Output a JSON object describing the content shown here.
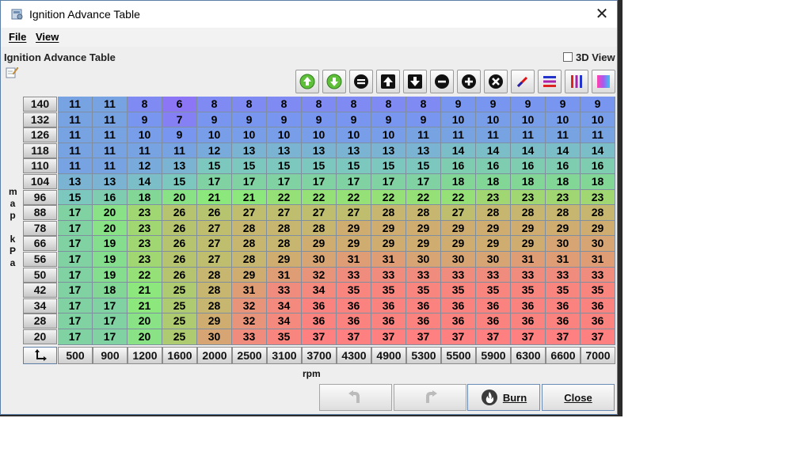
{
  "window": {
    "title": "Ignition Advance Table"
  },
  "menu": {
    "file": "File",
    "view": "View"
  },
  "panel": {
    "title": "Ignition Advance Table",
    "view3d_label": "3D View",
    "view3d_checked": false
  },
  "toolbar": [
    {
      "name": "green-circle-up-button",
      "icon": "green-up-arrow-icon"
    },
    {
      "name": "green-circle-down-button",
      "icon": "green-down-arrow-icon"
    },
    {
      "name": "set-equal-button",
      "icon": "equals-icon"
    },
    {
      "name": "increment-button",
      "icon": "up-arrow-icon"
    },
    {
      "name": "decrement-button",
      "icon": "down-arrow-icon"
    },
    {
      "name": "subtract-button",
      "icon": "minus-icon"
    },
    {
      "name": "add-button",
      "icon": "plus-icon"
    },
    {
      "name": "multiply-button",
      "icon": "times-icon"
    },
    {
      "name": "interpolate-button",
      "icon": "pen-icon"
    },
    {
      "name": "horizontal-interpolate-button",
      "icon": "horizontal-bars-icon"
    },
    {
      "name": "vertical-interpolate-button",
      "icon": "vertical-bars-icon"
    },
    {
      "name": "smooth-button",
      "icon": "gradient-icon"
    }
  ],
  "table": {
    "y_axis_label": [
      "m",
      "a",
      "p",
      "",
      "k",
      "P",
      "a"
    ],
    "x_axis_label": "rpm",
    "y_bins": [
      "140",
      "132",
      "126",
      "118",
      "110",
      "104",
      "96",
      "88",
      "78",
      "66",
      "56",
      "50",
      "42",
      "34",
      "28",
      "20"
    ],
    "x_bins": [
      "500",
      "900",
      "1200",
      "1600",
      "2000",
      "2500",
      "3100",
      "3700",
      "4300",
      "4900",
      "5300",
      "5500",
      "5900",
      "6300",
      "6600",
      "7000"
    ],
    "values": [
      [
        "11",
        "11",
        "8",
        "6",
        "8",
        "8",
        "8",
        "8",
        "8",
        "8",
        "8",
        "9",
        "9",
        "9",
        "9",
        "9"
      ],
      [
        "11",
        "11",
        "9",
        "7",
        "9",
        "9",
        "9",
        "9",
        "9",
        "9",
        "9",
        "10",
        "10",
        "10",
        "10",
        "10"
      ],
      [
        "11",
        "11",
        "10",
        "9",
        "10",
        "10",
        "10",
        "10",
        "10",
        "10",
        "11",
        "11",
        "11",
        "11",
        "11",
        "11"
      ],
      [
        "11",
        "11",
        "11",
        "11",
        "12",
        "13",
        "13",
        "13",
        "13",
        "13",
        "13",
        "14",
        "14",
        "14",
        "14",
        "14"
      ],
      [
        "11",
        "11",
        "12",
        "13",
        "15",
        "15",
        "15",
        "15",
        "15",
        "15",
        "15",
        "16",
        "16",
        "16",
        "16",
        "16"
      ],
      [
        "13",
        "13",
        "14",
        "15",
        "17",
        "17",
        "17",
        "17",
        "17",
        "17",
        "17",
        "18",
        "18",
        "18",
        "18",
        "18"
      ],
      [
        "15",
        "16",
        "18",
        "20",
        "21",
        "21",
        "22",
        "22",
        "22",
        "22",
        "22",
        "22",
        "23",
        "23",
        "23",
        "23"
      ],
      [
        "17",
        "20",
        "23",
        "26",
        "26",
        "27",
        "27",
        "27",
        "27",
        "28",
        "28",
        "27",
        "28",
        "28",
        "28",
        "28"
      ],
      [
        "17",
        "20",
        "23",
        "26",
        "27",
        "28",
        "28",
        "28",
        "29",
        "29",
        "29",
        "29",
        "29",
        "29",
        "29",
        "29"
      ],
      [
        "17",
        "19",
        "23",
        "26",
        "27",
        "28",
        "28",
        "29",
        "29",
        "29",
        "29",
        "29",
        "29",
        "29",
        "30",
        "30"
      ],
      [
        "17",
        "19",
        "23",
        "26",
        "27",
        "28",
        "29",
        "30",
        "31",
        "31",
        "30",
        "30",
        "30",
        "31",
        "31",
        "31"
      ],
      [
        "17",
        "19",
        "22",
        "26",
        "28",
        "29",
        "31",
        "32",
        "33",
        "33",
        "33",
        "33",
        "33",
        "33",
        "33",
        "33"
      ],
      [
        "17",
        "18",
        "21",
        "25",
        "28",
        "31",
        "33",
        "34",
        "35",
        "35",
        "35",
        "35",
        "35",
        "35",
        "35",
        "35"
      ],
      [
        "17",
        "17",
        "21",
        "25",
        "28",
        "32",
        "34",
        "36",
        "36",
        "36",
        "36",
        "36",
        "36",
        "36",
        "36",
        "36"
      ],
      [
        "17",
        "17",
        "20",
        "25",
        "29",
        "32",
        "34",
        "36",
        "36",
        "36",
        "36",
        "36",
        "36",
        "36",
        "36",
        "36"
      ],
      [
        "17",
        "17",
        "20",
        "25",
        "30",
        "33",
        "35",
        "37",
        "37",
        "37",
        "37",
        "37",
        "37",
        "37",
        "37",
        "37"
      ]
    ]
  },
  "buttons": {
    "undo": "",
    "redo": "",
    "burn": "Burn",
    "close": "Close"
  },
  "colors": {
    "min": "#8a7cf3",
    "mid": "#8be08a",
    "max": "#ff8888"
  }
}
